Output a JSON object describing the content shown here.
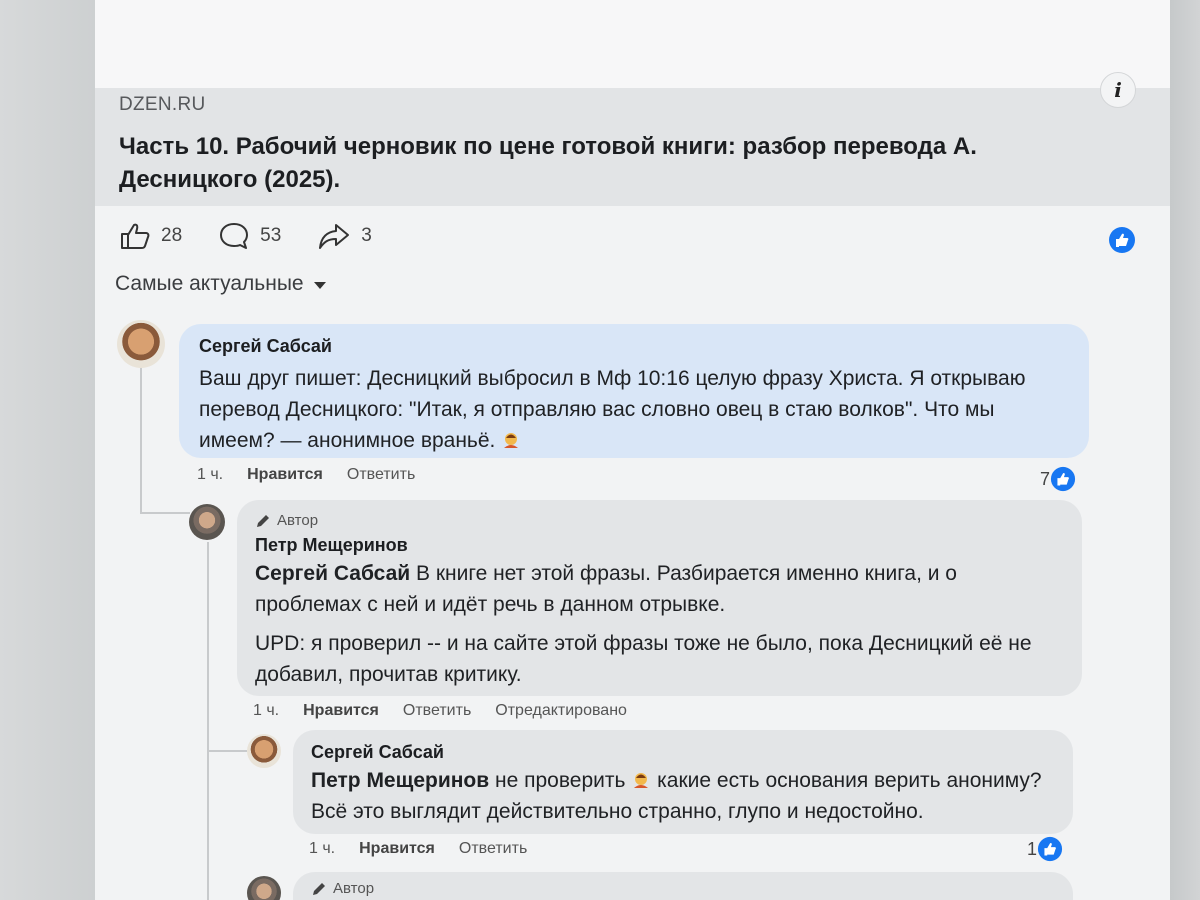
{
  "post": {
    "domain": "DZEN.RU",
    "title": "Часть 10. Рабочий черновик по цене готовой книги: разбор перевода А. Десницкого (2025).",
    "likes": "28",
    "comments": "53",
    "shares": "3"
  },
  "sort_label": "Самые актуальные",
  "comments": [
    {
      "author": "Сергей Сабсай",
      "text": "Ваш друг пишет: Десницкий выбросил в Мф 10:16 целую фразу Христа. Я открываю перевод Десницкого: \"Итак, я отправляю вас словно овец в стаю волков\". Что мы имеем? — анонимное враньё.",
      "time": "1 ч.",
      "like_label": "Нравится",
      "reply_label": "Ответить",
      "reactions": "7"
    },
    {
      "author_badge": "Автор",
      "author": "Петр Мещеринов",
      "mention": "Сергей Сабсай",
      "text1": "В книге нет этой фразы. Разбирается именно книга, и о проблемах с ней и идёт речь в данном отрывке.",
      "text2": "UPD: я проверил -- и на сайте этой фразы тоже не было, пока Десницкий её не добавил, прочитав критику.",
      "time": "1 ч.",
      "like_label": "Нравится",
      "reply_label": "Ответить",
      "edited_label": "Отредактировано"
    },
    {
      "author": "Сергей Сабсай",
      "mention": "Петр Мещеринов",
      "text_a": "не проверить",
      "text_b": "какие есть основания верить анониму? Всё это выглядит действительно странно, глупо и недостойно.",
      "time": "1 ч.",
      "like_label": "Нравится",
      "reply_label": "Ответить",
      "reactions": "1"
    },
    {
      "author_badge": "Автор"
    }
  ],
  "colors": {
    "like_blue": "#1877f2",
    "bubble_blue": "#d9e6f7",
    "bubble_grey": "#e3e5e7"
  },
  "icons": [
    "info-icon",
    "like-icon",
    "comment-icon",
    "share-icon",
    "thumbs-up-badge-icon",
    "pencil-icon",
    "woman-facepalm-emoji"
  ]
}
